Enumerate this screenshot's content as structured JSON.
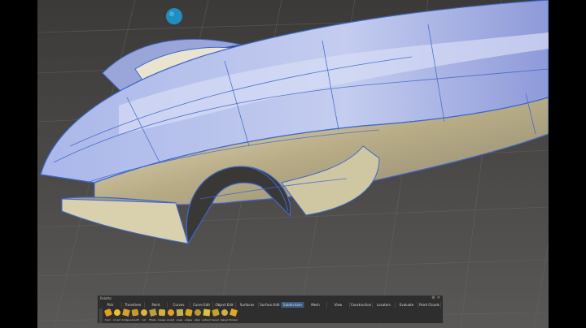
{
  "palette": {
    "title": "Palette",
    "tabs": [
      {
        "label": "Pick",
        "active": false
      },
      {
        "label": "Transform",
        "active": false
      },
      {
        "label": "Paint",
        "active": false
      },
      {
        "label": "Curves",
        "active": false
      },
      {
        "label": "Curve Edit",
        "active": false
      },
      {
        "label": "Object Edit",
        "active": false
      },
      {
        "label": "Surfaces",
        "active": false
      },
      {
        "label": "Surface Edit",
        "active": false
      },
      {
        "label": "Subdivision",
        "active": true
      },
      {
        "label": "Mesh",
        "active": false
      },
      {
        "label": "View",
        "active": false
      },
      {
        "label": "Construction",
        "active": false
      },
      {
        "label": "Locators",
        "active": false
      },
      {
        "label": "Evaluate",
        "active": false
      },
      {
        "label": "Point Clouds",
        "active": false
      }
    ],
    "tools": [
      {
        "label": "tcycl"
      },
      {
        "label": "cd ext"
      },
      {
        "label": "bridge"
      },
      {
        "label": "smooth"
      },
      {
        "label": "cut"
      },
      {
        "label": "fillets"
      },
      {
        "label": "crease"
      },
      {
        "label": "sculpt"
      },
      {
        "label": "snap"
      },
      {
        "label": "edges"
      },
      {
        "label": "align"
      },
      {
        "label": "extend"
      },
      {
        "label": "bevel"
      },
      {
        "label": "planar"
      },
      {
        "label": "thicken"
      }
    ]
  }
}
